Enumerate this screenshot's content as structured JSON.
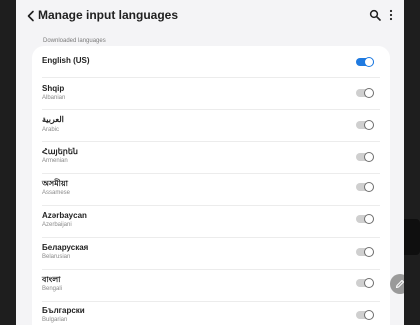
{
  "header": {
    "title": "Manage input languages",
    "back_icon": "back-arrow-icon",
    "search_icon": "search-icon",
    "more_icon": "more-vertical-icon"
  },
  "section": {
    "label": "Downloaded languages"
  },
  "languages": [
    {
      "name": "English (US)",
      "sub": "",
      "enabled": true
    },
    {
      "name": "Shqip",
      "sub": "Albanian",
      "enabled": false
    },
    {
      "name": "العربية",
      "sub": "Arabic",
      "enabled": false
    },
    {
      "name": "Հայերեն",
      "sub": "Armenian",
      "enabled": false
    },
    {
      "name": "অসমীয়া",
      "sub": "Assamese",
      "enabled": false
    },
    {
      "name": "Azərbaycan",
      "sub": "Azerbaijani",
      "enabled": false
    },
    {
      "name": "Беларуская",
      "sub": "Belarusian",
      "enabled": false
    },
    {
      "name": "বাংলা",
      "sub": "Bengali",
      "enabled": false
    },
    {
      "name": "Български",
      "sub": "Bulgarian",
      "enabled": false
    }
  ],
  "colors": {
    "accent": "#1f7ae0",
    "toggle_off": "#cfcfcf",
    "background": "#f4f4f6"
  },
  "fab_icon": "pencil-icon"
}
